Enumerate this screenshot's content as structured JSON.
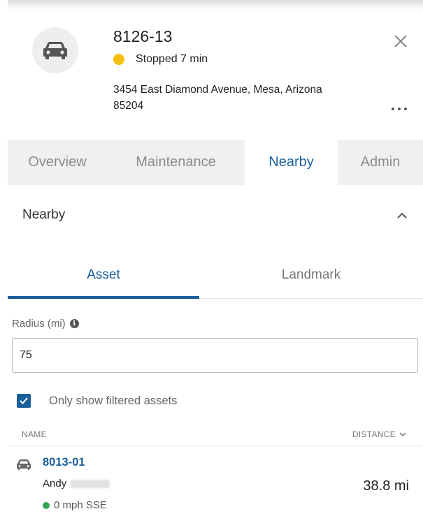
{
  "header": {
    "asset_id": "8126-13",
    "status_text": "Stopped 7 min",
    "address_line1": "3454 East Diamond Avenue, Mesa, Arizona",
    "address_line2": "85204",
    "status_color": "#f5bf12"
  },
  "tabs": [
    {
      "label": "Overview",
      "active": false
    },
    {
      "label": "Maintenance",
      "active": false
    },
    {
      "label": "Nearby",
      "active": true
    },
    {
      "label": "Admin",
      "active": false
    }
  ],
  "nearby": {
    "title": "Nearby",
    "subtabs": {
      "asset": "Asset",
      "landmark": "Landmark"
    },
    "radius_label": "Radius (mi)",
    "radius_value": "75",
    "only_filtered_label": "Only show filtered assets",
    "only_filtered_checked": true,
    "columns": {
      "name": "NAME",
      "distance": "DISTANCE"
    },
    "results": [
      {
        "asset_id": "8013-01",
        "driver": "Andy",
        "speed": "0 mph SSE",
        "distance": "38.8 mi"
      }
    ]
  },
  "colors": {
    "accent": "#1a5f9c",
    "moving": "#34a853"
  },
  "icons": {
    "asset": "car-icon",
    "close": "close-icon",
    "more": "more-options-icon",
    "collapse": "chevron-up-icon",
    "info": "info-icon",
    "sort": "chevron-down-icon"
  }
}
